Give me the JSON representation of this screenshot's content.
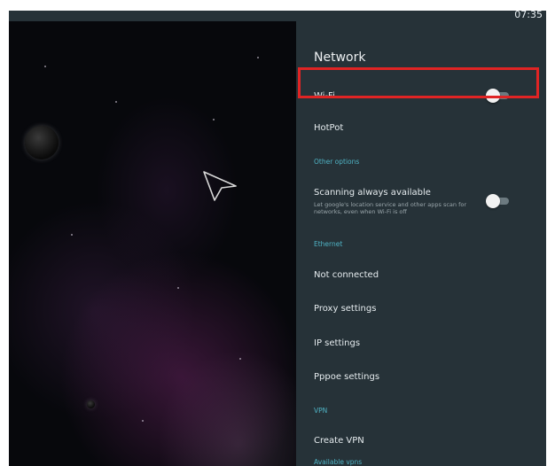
{
  "status_bar": {
    "time": "07:35"
  },
  "settings": {
    "title": "Network",
    "wifi": {
      "label": "Wi-Fi",
      "enabled": false
    },
    "hotspot": {
      "label": "HotPot"
    },
    "other_options": {
      "header": "Other options",
      "scanning": {
        "label": "Scanning always available",
        "description": "Let google's location service and other apps scan for networks, even when Wi-Fi is off",
        "enabled": false
      }
    },
    "ethernet": {
      "header": "Ethernet",
      "status": "Not connected",
      "proxy": "Proxy settings",
      "ip": "IP settings",
      "pppoe": "Pppoe settings"
    },
    "vpn": {
      "header": "VPN",
      "create": "Create VPN",
      "available_header": "Available vpns"
    }
  },
  "colors": {
    "panel_bg": "#263238",
    "section_accent": "#4fb3c4",
    "highlight": "#e02424"
  },
  "icons": [
    "mouse-pointer-icon"
  ]
}
